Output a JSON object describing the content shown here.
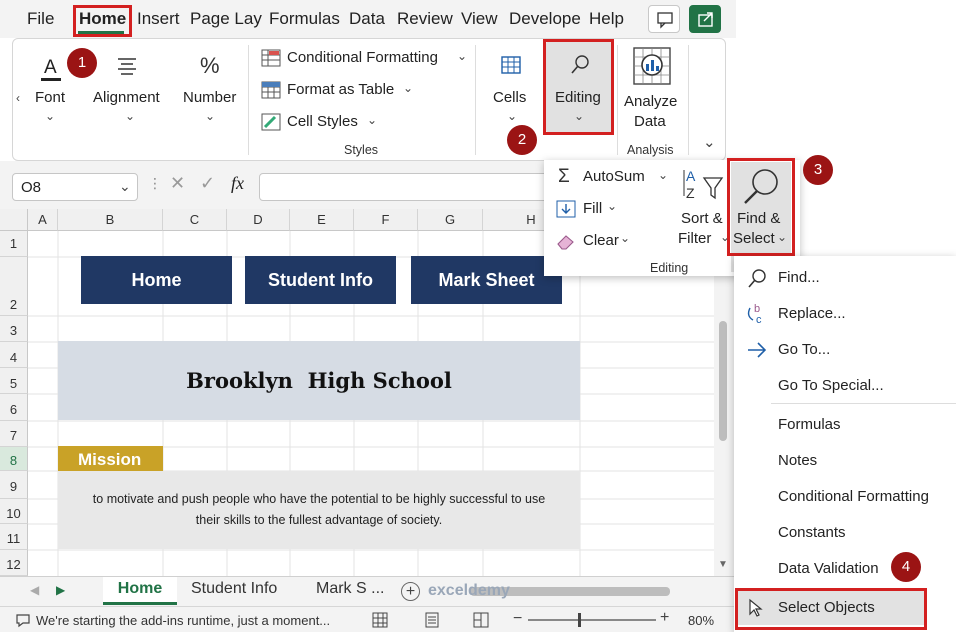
{
  "tabs": [
    "File",
    "Home",
    "Insert",
    "Page Layo",
    "Formulas",
    "Data",
    "Review",
    "View",
    "Develope",
    "Help"
  ],
  "ribbon": {
    "font": "Font",
    "alignment": "Alignment",
    "number": "Number",
    "conditional_formatting": "Conditional Formatting",
    "format_as_table": "Format as Table",
    "cell_styles": "Cell Styles",
    "styles_group": "Styles",
    "cells": "Cells",
    "editing": "Editing",
    "analyze_data_1": "Analyze",
    "analyze_data_2": "Data",
    "analysis_group": "Analysis"
  },
  "editing_panel": {
    "autosum": "AutoSum",
    "fill": "Fill",
    "clear": "Clear",
    "sort_filter_1": "Sort &",
    "sort_filter_2": "Filter",
    "find_select_1": "Find &",
    "find_select_2": "Select",
    "group": "Editing"
  },
  "formula_bar": {
    "name_box": "O8",
    "fx": "fx"
  },
  "columns": [
    "A",
    "B",
    "C",
    "D",
    "E",
    "F",
    "G",
    "H"
  ],
  "rows": [
    "1",
    "2",
    "3",
    "4",
    "5",
    "6",
    "7",
    "8",
    "9",
    "10",
    "11",
    "12"
  ],
  "sheet": {
    "nav_buttons": [
      "Home",
      "Student Info",
      "Mark Sheet"
    ],
    "title": "Brooklyn  High School",
    "mission_label": "Mission",
    "mission_text_1": "to motivate and push people who have the potential to be highly successful to use",
    "mission_text_2": "their skills to the fullest advantage of society."
  },
  "sheet_tabs": [
    "Home",
    "Student Info",
    "Mark S ..."
  ],
  "status": {
    "message": "We're starting the add-ins runtime, just a moment...",
    "zoom": "80%"
  },
  "find_menu": [
    "Find...",
    "Replace...",
    "Go To...",
    "Go To Special...",
    "Formulas",
    "Notes",
    "Conditional Formatting",
    "Constants",
    "Data Validation",
    "Select Objects"
  ],
  "badges": [
    "1",
    "2",
    "3",
    "4"
  ],
  "watermark": "exceldemy",
  "colors": {
    "accent": "#217346",
    "navy": "#203864",
    "gold": "#c9a227",
    "highlight": "#d32020",
    "badge": "#9b1414"
  }
}
